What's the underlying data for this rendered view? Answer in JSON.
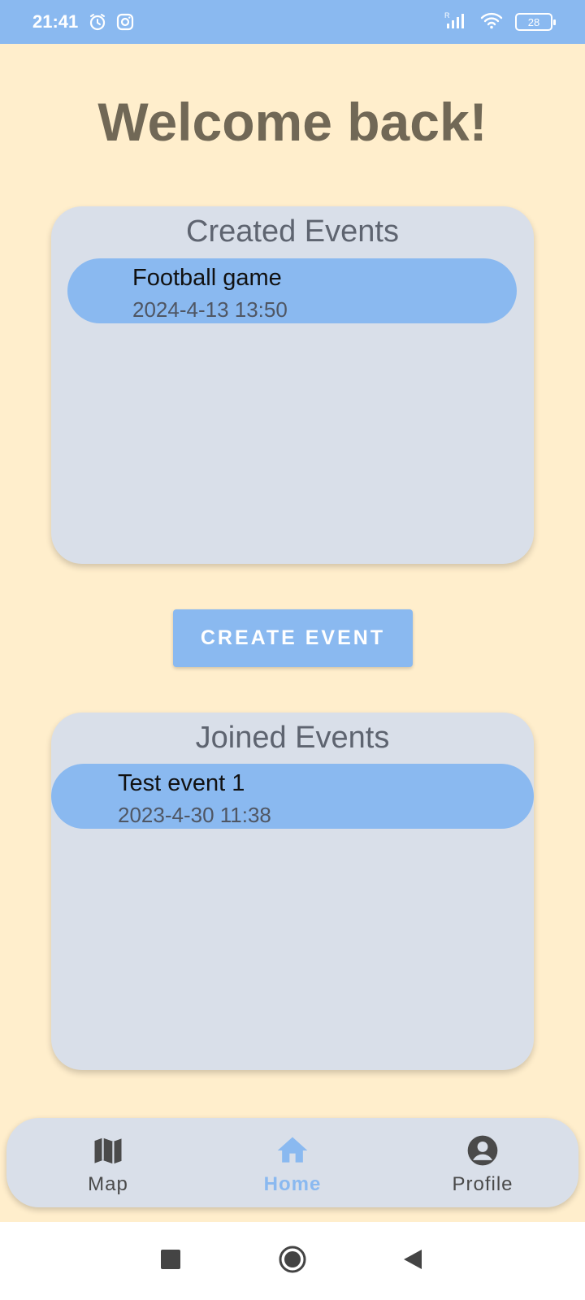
{
  "status_bar": {
    "time": "21:41",
    "battery": "28",
    "icons": [
      "alarm-icon",
      "instagram-icon",
      "signal-icon",
      "wifi-icon",
      "battery-icon"
    ]
  },
  "page_title": "Welcome back!",
  "created_events": {
    "title": "Created Events",
    "items": [
      {
        "name": "Football game",
        "date": "2024-4-13 13:50"
      }
    ]
  },
  "create_button_label": "CREATE EVENT",
  "joined_events": {
    "title": "Joined Events",
    "items": [
      {
        "name": "Test event 1",
        "date": "2023-4-30 11:38"
      }
    ]
  },
  "bottom_nav": {
    "items": [
      {
        "label": "Map",
        "icon": "map-icon",
        "active": false
      },
      {
        "label": "Home",
        "icon": "home-icon",
        "active": true
      },
      {
        "label": "Profile",
        "icon": "account-circle-icon",
        "active": false
      }
    ]
  },
  "colors": {
    "background": "#FFEECC",
    "accent": "#8AB9F0",
    "panel": "#D9DFE9",
    "title": "#716856"
  }
}
